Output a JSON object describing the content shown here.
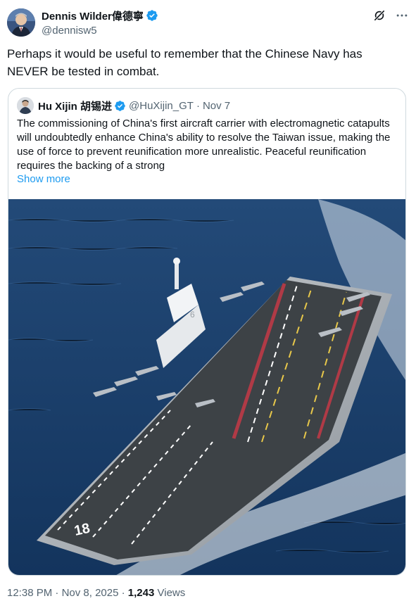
{
  "tweet": {
    "author_name": "Dennis Wilder偉德寧",
    "author_handle": "@dennisw5",
    "text": "Perhaps it would be useful to remember that the Chinese Navy has NEVER be tested in combat."
  },
  "quote": {
    "author_name": "Hu Xijin 胡锡进",
    "author_handle": "@HuXijin_GT",
    "separator": "·",
    "date": "Nov 7",
    "text": "The commissioning of China's first aircraft carrier with electromagnetic catapults will undoubtedly enhance China's ability to resolve the Taiwan issue, making the use of force to prevent reunification more unrealistic. Peaceful reunification requires the backing of a strong",
    "show_more": "Show more",
    "media_alt": "Aircraft carrier with fighter jets on deck at sea",
    "deck_number": "18"
  },
  "footer": {
    "time": "12:38 PM",
    "sep1": "·",
    "date": "Nov 8, 2025",
    "sep2": "·",
    "views_count": "1,243",
    "views_label": "Views"
  },
  "icons": {
    "verified": "verified-badge-icon",
    "grok": "grok-icon",
    "more": "more-icon"
  },
  "colors": {
    "accent": "#1d9bf0",
    "text": "#0f1419",
    "secondary": "#536471",
    "border": "#cfd9de"
  }
}
